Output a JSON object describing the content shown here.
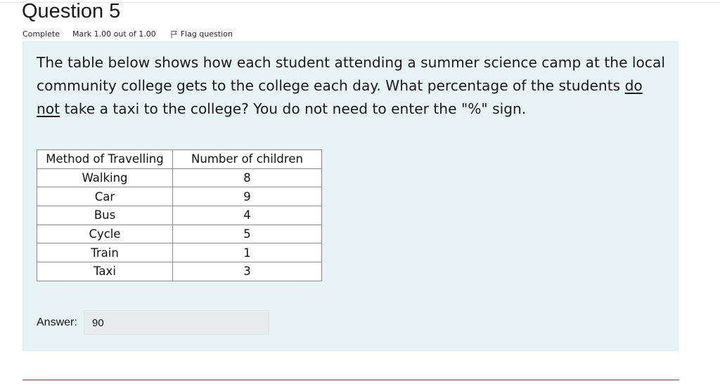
{
  "question": {
    "title": "Question 5",
    "status": "Complete",
    "mark": "Mark 1.00 out of 1.00",
    "flag_label": "Flag question",
    "text_part1": "The table below shows how each student attending a summer science camp at the local community college gets to the college each day. What percentage of the students ",
    "text_underlined": "do not",
    "text_part2": " take a taxi to the college? You do not need to enter the \"%\" sign."
  },
  "table": {
    "headers": [
      "Method of Travelling",
      "Number of children"
    ],
    "rows": [
      [
        "Walking",
        "8"
      ],
      [
        "Car",
        "9"
      ],
      [
        "Bus",
        "4"
      ],
      [
        "Cycle",
        "5"
      ],
      [
        "Train",
        "1"
      ],
      [
        "Taxi",
        "3"
      ]
    ]
  },
  "answer": {
    "label": "Answer:",
    "value": "90"
  },
  "colors": {
    "question_bg": "#e7f3f5",
    "input_bg": "#e9ecef",
    "bottom_rule": "#8c3a2a"
  },
  "icons": {
    "flag": "flag-icon"
  }
}
